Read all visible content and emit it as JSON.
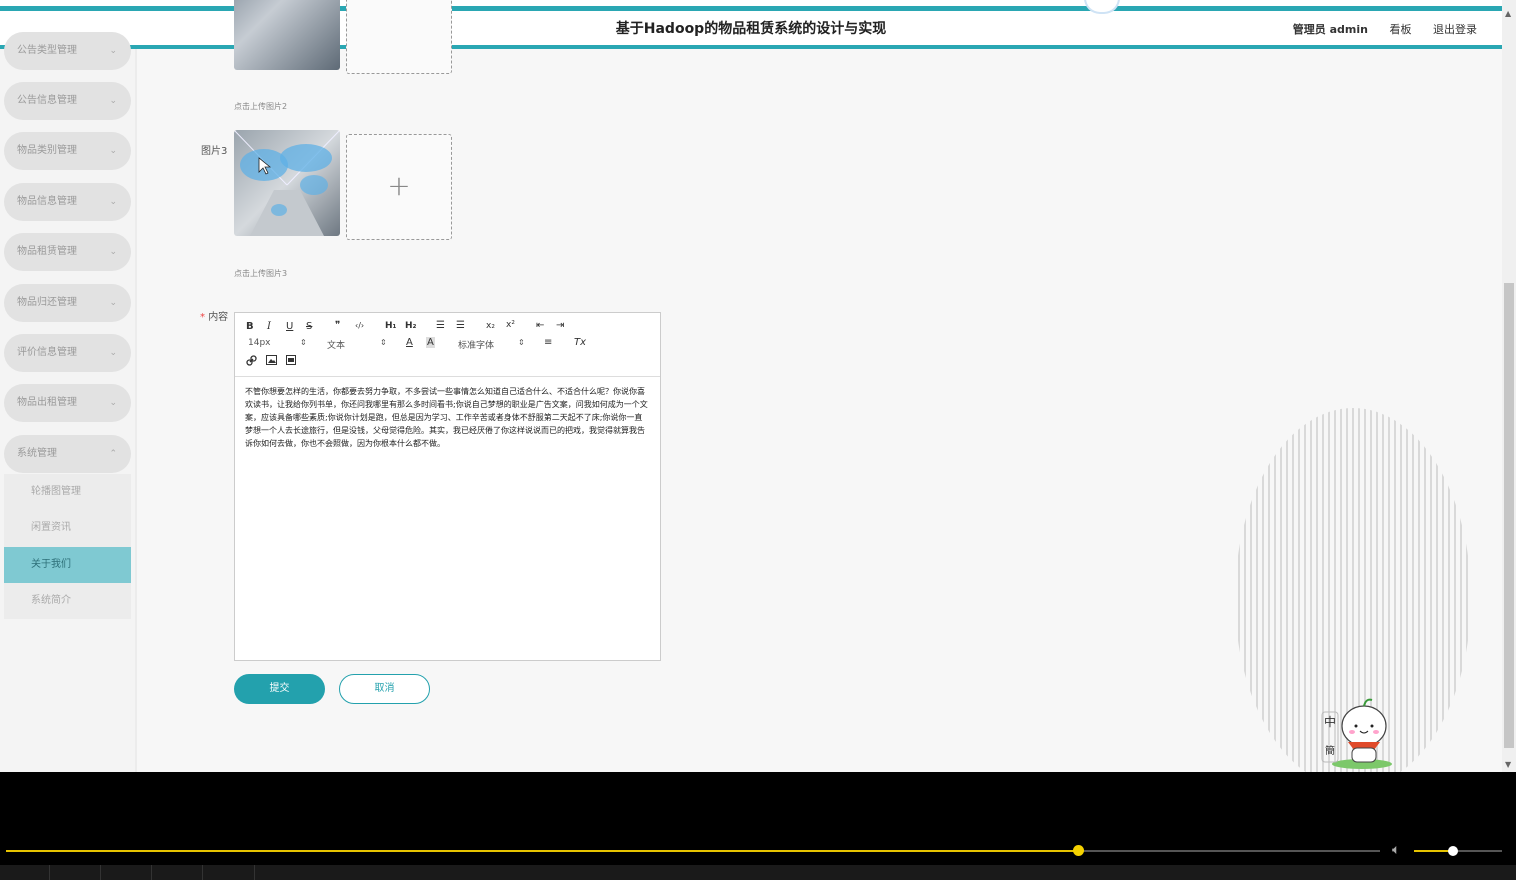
{
  "header": {
    "title": "基于Hadoop的物品租赁系统的设计与实现",
    "user_label": "管理员 admin",
    "dashboard_link": "看板",
    "logout_link": "退出登录"
  },
  "sidebar": {
    "items": [
      {
        "label": "公告类型管理"
      },
      {
        "label": "公告信息管理"
      },
      {
        "label": "物品类别管理"
      },
      {
        "label": "物品信息管理"
      },
      {
        "label": "物品租赁管理"
      },
      {
        "label": "物品归还管理"
      },
      {
        "label": "评价信息管理"
      },
      {
        "label": "物品出租管理"
      },
      {
        "label": "系统管理"
      }
    ],
    "submenu": [
      {
        "label": "轮播图管理"
      },
      {
        "label": "闲置资讯"
      },
      {
        "label": "关于我们"
      },
      {
        "label": "系统简介"
      }
    ]
  },
  "form": {
    "upload2_hint": "点击上传图片2",
    "image3_label": "图片3",
    "upload3_hint": "点击上传图片3",
    "content_label": "内容",
    "required_mark": "*",
    "editor": {
      "toolbar": {
        "bold": "B",
        "italic": "I",
        "underline": "U",
        "strike": "S",
        "quote": "❞",
        "code": "‹/›",
        "h1": "H₁",
        "h2": "H₂",
        "ordered_list": "☰",
        "bullet_list": "☰",
        "subscript": "x₂",
        "superscript": "x²",
        "outdent": "⇤",
        "indent": "⇥",
        "size_select": "14px",
        "type_select": "文本",
        "font_select": "标准字体",
        "color": "A",
        "background": "A",
        "align": "≡",
        "clear": "Tx"
      },
      "content": "不管你想要怎样的生活，你都要去努力争取，不多尝试一些事情怎么知道自己适合什么、不适合什么呢？你说你喜欢读书，让我给你列书单，你还问我哪里有那么多时间看书;你说自己梦想的职业是广告文案，问我如何成为一个文案，应该具备哪些素质;你说你计划是跑，但总是因为学习、工作辛苦或者身体不舒服第二天起不了床;你说你一直梦想一个人去长途旅行，但是没钱，父母觉得危险。其实，我已经厌倦了你这样说说而已的把戏，我觉得就算我告诉你如何去做，你也不会照做，因为你根本什么都不做。"
    },
    "submit_label": "提交",
    "cancel_label": "取消"
  },
  "player": {
    "progress": 0.78,
    "volume": 0.44
  },
  "colors": {
    "accent": "#23a1ad",
    "active_menu": "#7fc9d2",
    "seek": "#e6c300"
  }
}
